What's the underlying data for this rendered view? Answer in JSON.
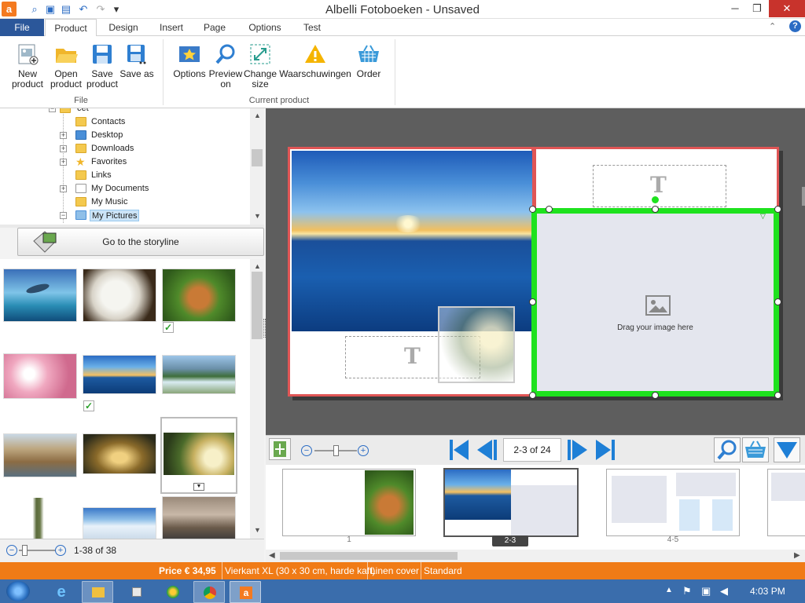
{
  "app": {
    "title": "Albelli Fotoboeken - Unsaved",
    "logo_letter": "a",
    "window_controls": {
      "minimize": "─",
      "restore": "❐",
      "close": "✕"
    }
  },
  "quick_access": [
    "search-icon",
    "image-icon",
    "save-icon",
    "undo-icon",
    "redo-icon",
    "customize-icon"
  ],
  "tabs": [
    "File",
    "Product",
    "Design",
    "Insert",
    "Page",
    "Options",
    "Test"
  ],
  "ribbon": {
    "groups": [
      {
        "label": "File",
        "buttons": [
          {
            "label": "New product",
            "icon": "new-product-icon"
          },
          {
            "label": "Open product",
            "icon": "open-folder-icon"
          },
          {
            "label": "Save product",
            "icon": "save-icon"
          },
          {
            "label": "Save as",
            "icon": "save-as-icon"
          }
        ]
      },
      {
        "label": "Current product",
        "buttons": [
          {
            "label": "Options",
            "icon": "options-icon"
          },
          {
            "label": "Preview on",
            "icon": "magnifier-icon"
          },
          {
            "label": "Change size",
            "icon": "resize-icon"
          },
          {
            "label": "Waarschuwingen",
            "icon": "warning-icon"
          },
          {
            "label": "Order",
            "icon": "basket-icon"
          }
        ]
      }
    ]
  },
  "tree": {
    "partial_top": "cet",
    "items": [
      {
        "label": "Contacts",
        "expandable": false
      },
      {
        "label": "Desktop",
        "expandable": true
      },
      {
        "label": "Downloads",
        "expandable": true
      },
      {
        "label": "Favorites",
        "expandable": true
      },
      {
        "label": "Links",
        "expandable": false
      },
      {
        "label": "My Documents",
        "expandable": true
      },
      {
        "label": "My Music",
        "expandable": false
      },
      {
        "label": "My Pictures",
        "expandable": true,
        "expanded": true,
        "selected": true
      }
    ]
  },
  "storyline_button": "Go to the storyline",
  "gallery": {
    "photos": [
      {
        "name": "dolphins",
        "checked": false
      },
      {
        "name": "white-lion",
        "checked": false
      },
      {
        "name": "fox",
        "checked": true
      },
      {
        "name": "pink-blossom",
        "checked": false
      },
      {
        "name": "sunset-sea",
        "checked": true
      },
      {
        "name": "river-rapids",
        "checked": false
      },
      {
        "name": "city-riverside",
        "checked": false
      },
      {
        "name": "wave-tunnel",
        "checked": false
      },
      {
        "name": "tree-sunlight",
        "checked": false,
        "selected": true
      },
      {
        "name": "tree-trunk",
        "checked": false
      },
      {
        "name": "snow-mountain",
        "checked": false
      },
      {
        "name": "birds",
        "checked": false
      }
    ],
    "count_label": "1-38 of 38",
    "zoom_minus": "−",
    "zoom_plus": "+"
  },
  "canvas": {
    "text_placeholder_glyph": "T",
    "drop_hint": "Drag your image here"
  },
  "navigation": {
    "page_label": "2-3 of 24",
    "zoom_minus": "−",
    "zoom_plus": "+"
  },
  "thumb_strip": {
    "pages": [
      "1",
      "2-3",
      "4-5"
    ],
    "selected": "2-3"
  },
  "status": {
    "price": "Price € 34,95",
    "format": "Vierkant XL (30 x 30 cm, harde kaft)",
    "cover": "Linen cover",
    "paper": "Standard"
  },
  "taskbar": {
    "clock": "4:03 PM",
    "apps": [
      "start-icon",
      "internet-explorer-icon",
      "file-explorer-icon",
      "paint-icon",
      "media-icon",
      "chrome-icon",
      "albelli-icon"
    ]
  },
  "colors": {
    "file_tab": "#2b579a",
    "accent_orange": "#f07b16",
    "selection_green": "#1ee21e",
    "page_border_red": "#e05555",
    "taskbar": "#3a6dac"
  }
}
